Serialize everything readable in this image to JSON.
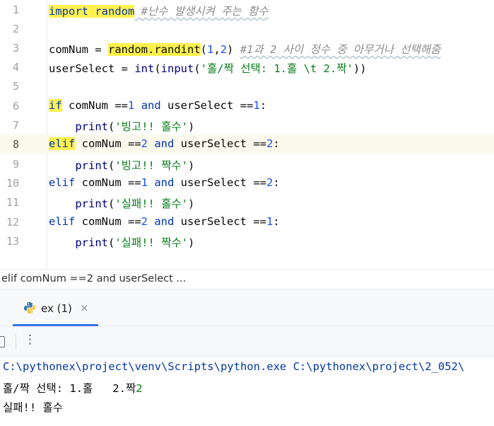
{
  "editor": {
    "lines": [
      {
        "num": "1"
      },
      {
        "num": "2"
      },
      {
        "num": "3"
      },
      {
        "num": "4"
      },
      {
        "num": "5"
      },
      {
        "num": "6"
      },
      {
        "num": "7"
      },
      {
        "num": "8"
      },
      {
        "num": "9"
      },
      {
        "num": "10"
      },
      {
        "num": "11"
      },
      {
        "num": "12"
      },
      {
        "num": "13"
      }
    ],
    "tokens": {
      "l1_import": "import random",
      "l1_comment": " #난수 발생시켜 주는 함수",
      "l3_a": "comNum = ",
      "l3_call": "random.randint",
      "l3_open": "(",
      "l3_n1": "1",
      "l3_comma": ",",
      "l3_n2": "2",
      "l3_close": ") ",
      "l3_comment": "#1과 2 사이 정수 중 아무거나 선택해줌",
      "l4_a": "userSelect = ",
      "l4_int": "int",
      "l4_b": "(",
      "l4_input": "input",
      "l4_c": "(",
      "l4_str": "'홀/짝 선택: 1.홀 \\t 2.짝'",
      "l4_d": "))",
      "kw_if": "if",
      "kw_elif": "elif",
      "kw_and": "and",
      "var_comNum": " comNum ==",
      "var_userSelect": " userSelect ==",
      "colon": ":",
      "n1": "1",
      "n2": "2",
      "print": "print",
      "paren_open": "(",
      "paren_close": ")",
      "s_bingo_odd": "'빙고!! 홀수'",
      "s_bingo_even": "'빙고!! 짝수'",
      "s_fail_odd": "'실패!! 홀수'",
      "s_fail_even": "'실패!! 짝수'",
      "indent": "    ",
      "space": " "
    }
  },
  "breadcrumb": "elif comNum ==2 and userSelect ...",
  "run_panel": {
    "tab_label": "ex (1)",
    "close_glyph": "×",
    "more_glyph": "⋮"
  },
  "console": {
    "command": "C:\\pythonex\\project\\venv\\Scripts\\python.exe C:\\pythonex\\project\\2_052\\",
    "prompt": "홀/짝 선택: 1.홀   2.짝",
    "input_value": "2",
    "result": "실패!! 홀수"
  },
  "colors": {
    "keyword": "#0033b3",
    "number": "#1750eb",
    "string": "#067d17",
    "comment": "#8c8c8c",
    "highlight": "#fff24d",
    "current_line": "#fcfaed",
    "accent": "#3574f0"
  }
}
